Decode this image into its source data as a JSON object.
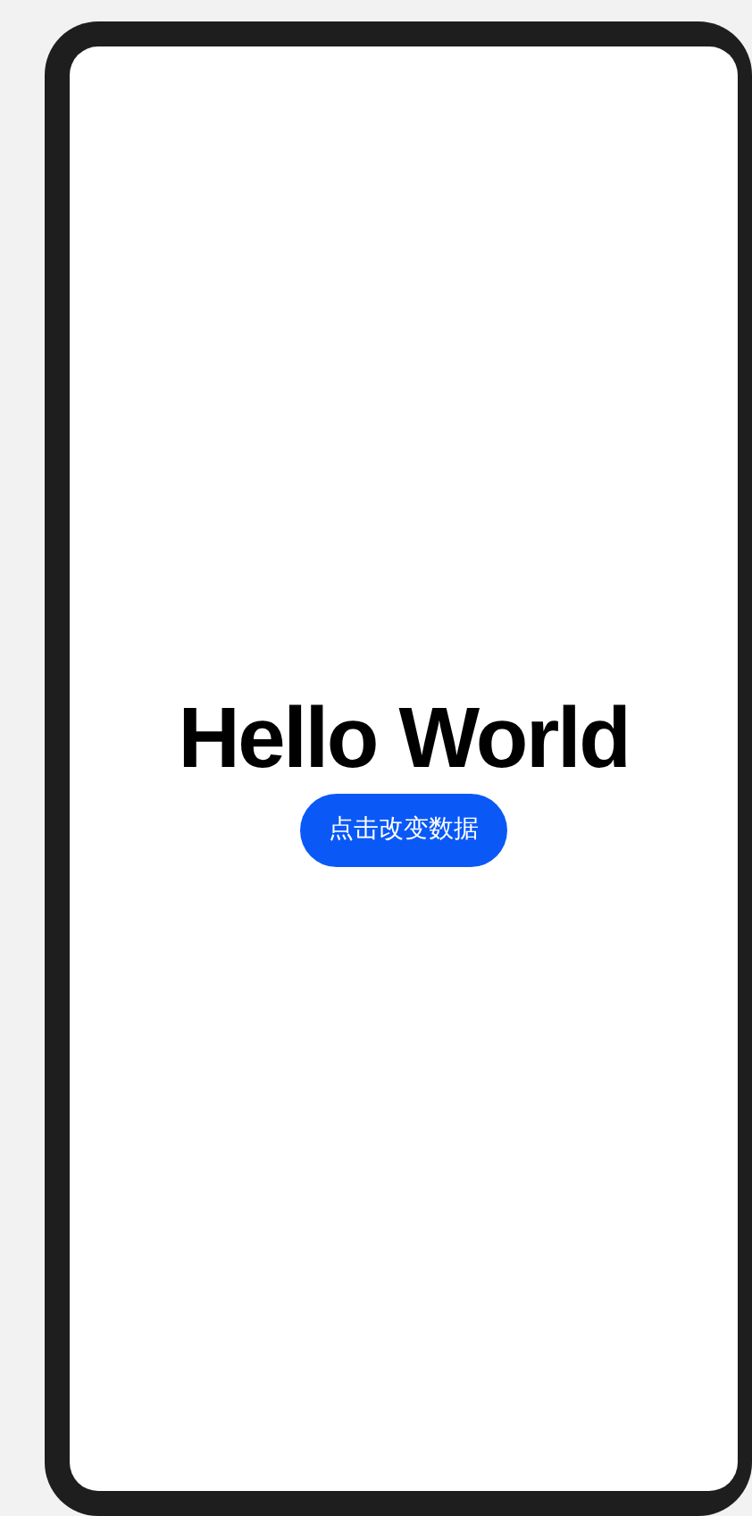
{
  "title": "Hello World",
  "button": {
    "label": "点击改变数据"
  }
}
